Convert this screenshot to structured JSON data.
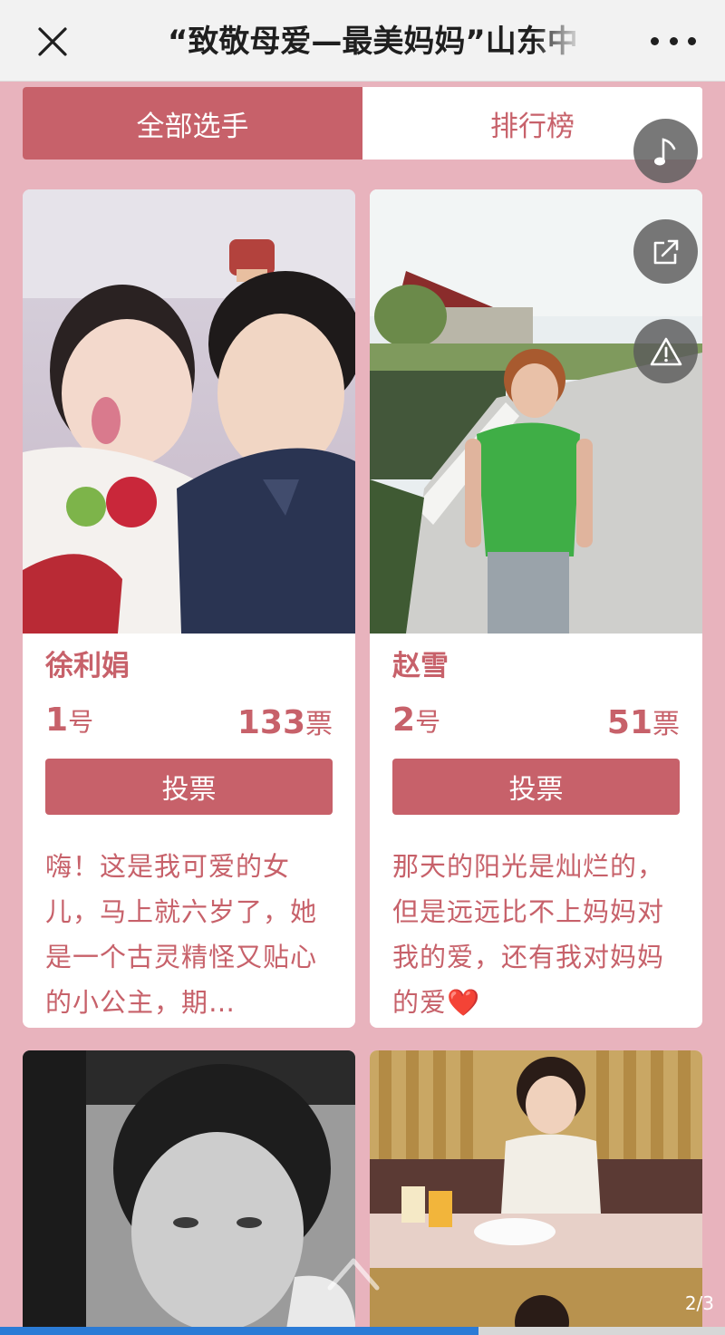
{
  "header": {
    "title": "“致敬母爱—最美妈妈”山东中",
    "close_icon": "close-icon",
    "more_icon": "more-dots-icon"
  },
  "tabs": [
    {
      "label": "全部选手",
      "active": true
    },
    {
      "label": "排行榜",
      "active": false
    }
  ],
  "floating_actions": [
    {
      "icon": "music-note-icon"
    },
    {
      "icon": "share-icon"
    },
    {
      "icon": "warning-icon"
    }
  ],
  "contestants": [
    {
      "name": "徐利娟",
      "number": "1",
      "number_unit": "号",
      "votes": "133",
      "votes_unit": "票",
      "vote_label": "投票",
      "description": "嗨！这是我可爱的女儿，马上就六岁了，她是一个古灵精怪又贴心的小公主，期…"
    },
    {
      "name": "赵雪",
      "number": "2",
      "number_unit": "号",
      "votes": "51",
      "votes_unit": "票",
      "vote_label": "投票",
      "description": "那天的阳光是灿烂的，但是远远比不上妈妈对我的爱，还有我对妈妈的爱❤️"
    }
  ],
  "pager": "2/3",
  "progress": 0.66,
  "colors": {
    "accent": "#c7616a",
    "background": "#e8b3bd",
    "progress": "#2b7bd6"
  }
}
